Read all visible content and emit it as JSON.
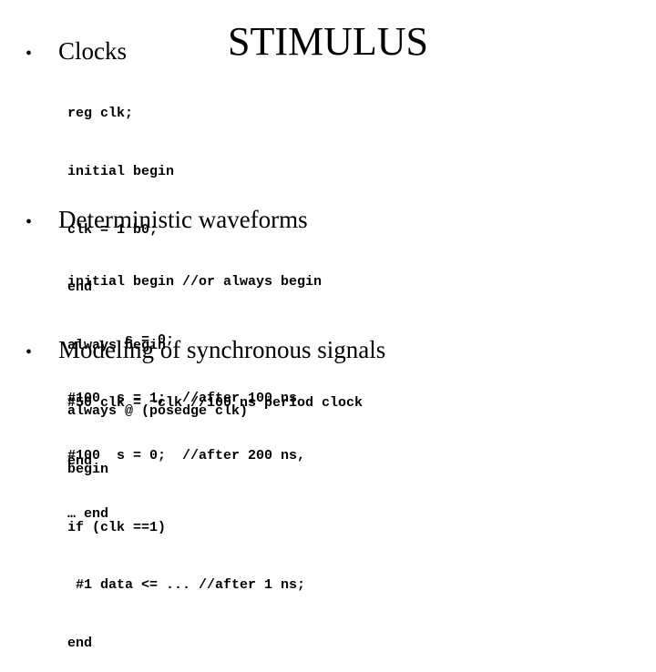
{
  "title": "STIMULUS",
  "sections": [
    {
      "heading": "Clocks",
      "code": [
        "reg clk;",
        "initial begin",
        "clk = 1’b0;",
        "end",
        "always begin",
        "#50 clk = ~clk //100 ns period clock",
        "end"
      ]
    },
    {
      "heading": "Deterministic waveforms",
      "code": [
        "initial begin //or always begin",
        "       s = 0;",
        "#100  s = 1;  //after 100 ns",
        "#100  s = 0;  //after 200 ns,",
        "… end"
      ]
    },
    {
      "heading": "Modeling of synchronous signals",
      "code": [
        "always @ (posedge clk)",
        "begin",
        "if (clk ==1)",
        " #1 data <= ... //after 1 ns;",
        "end"
      ]
    }
  ],
  "bullet_glyph": "•"
}
